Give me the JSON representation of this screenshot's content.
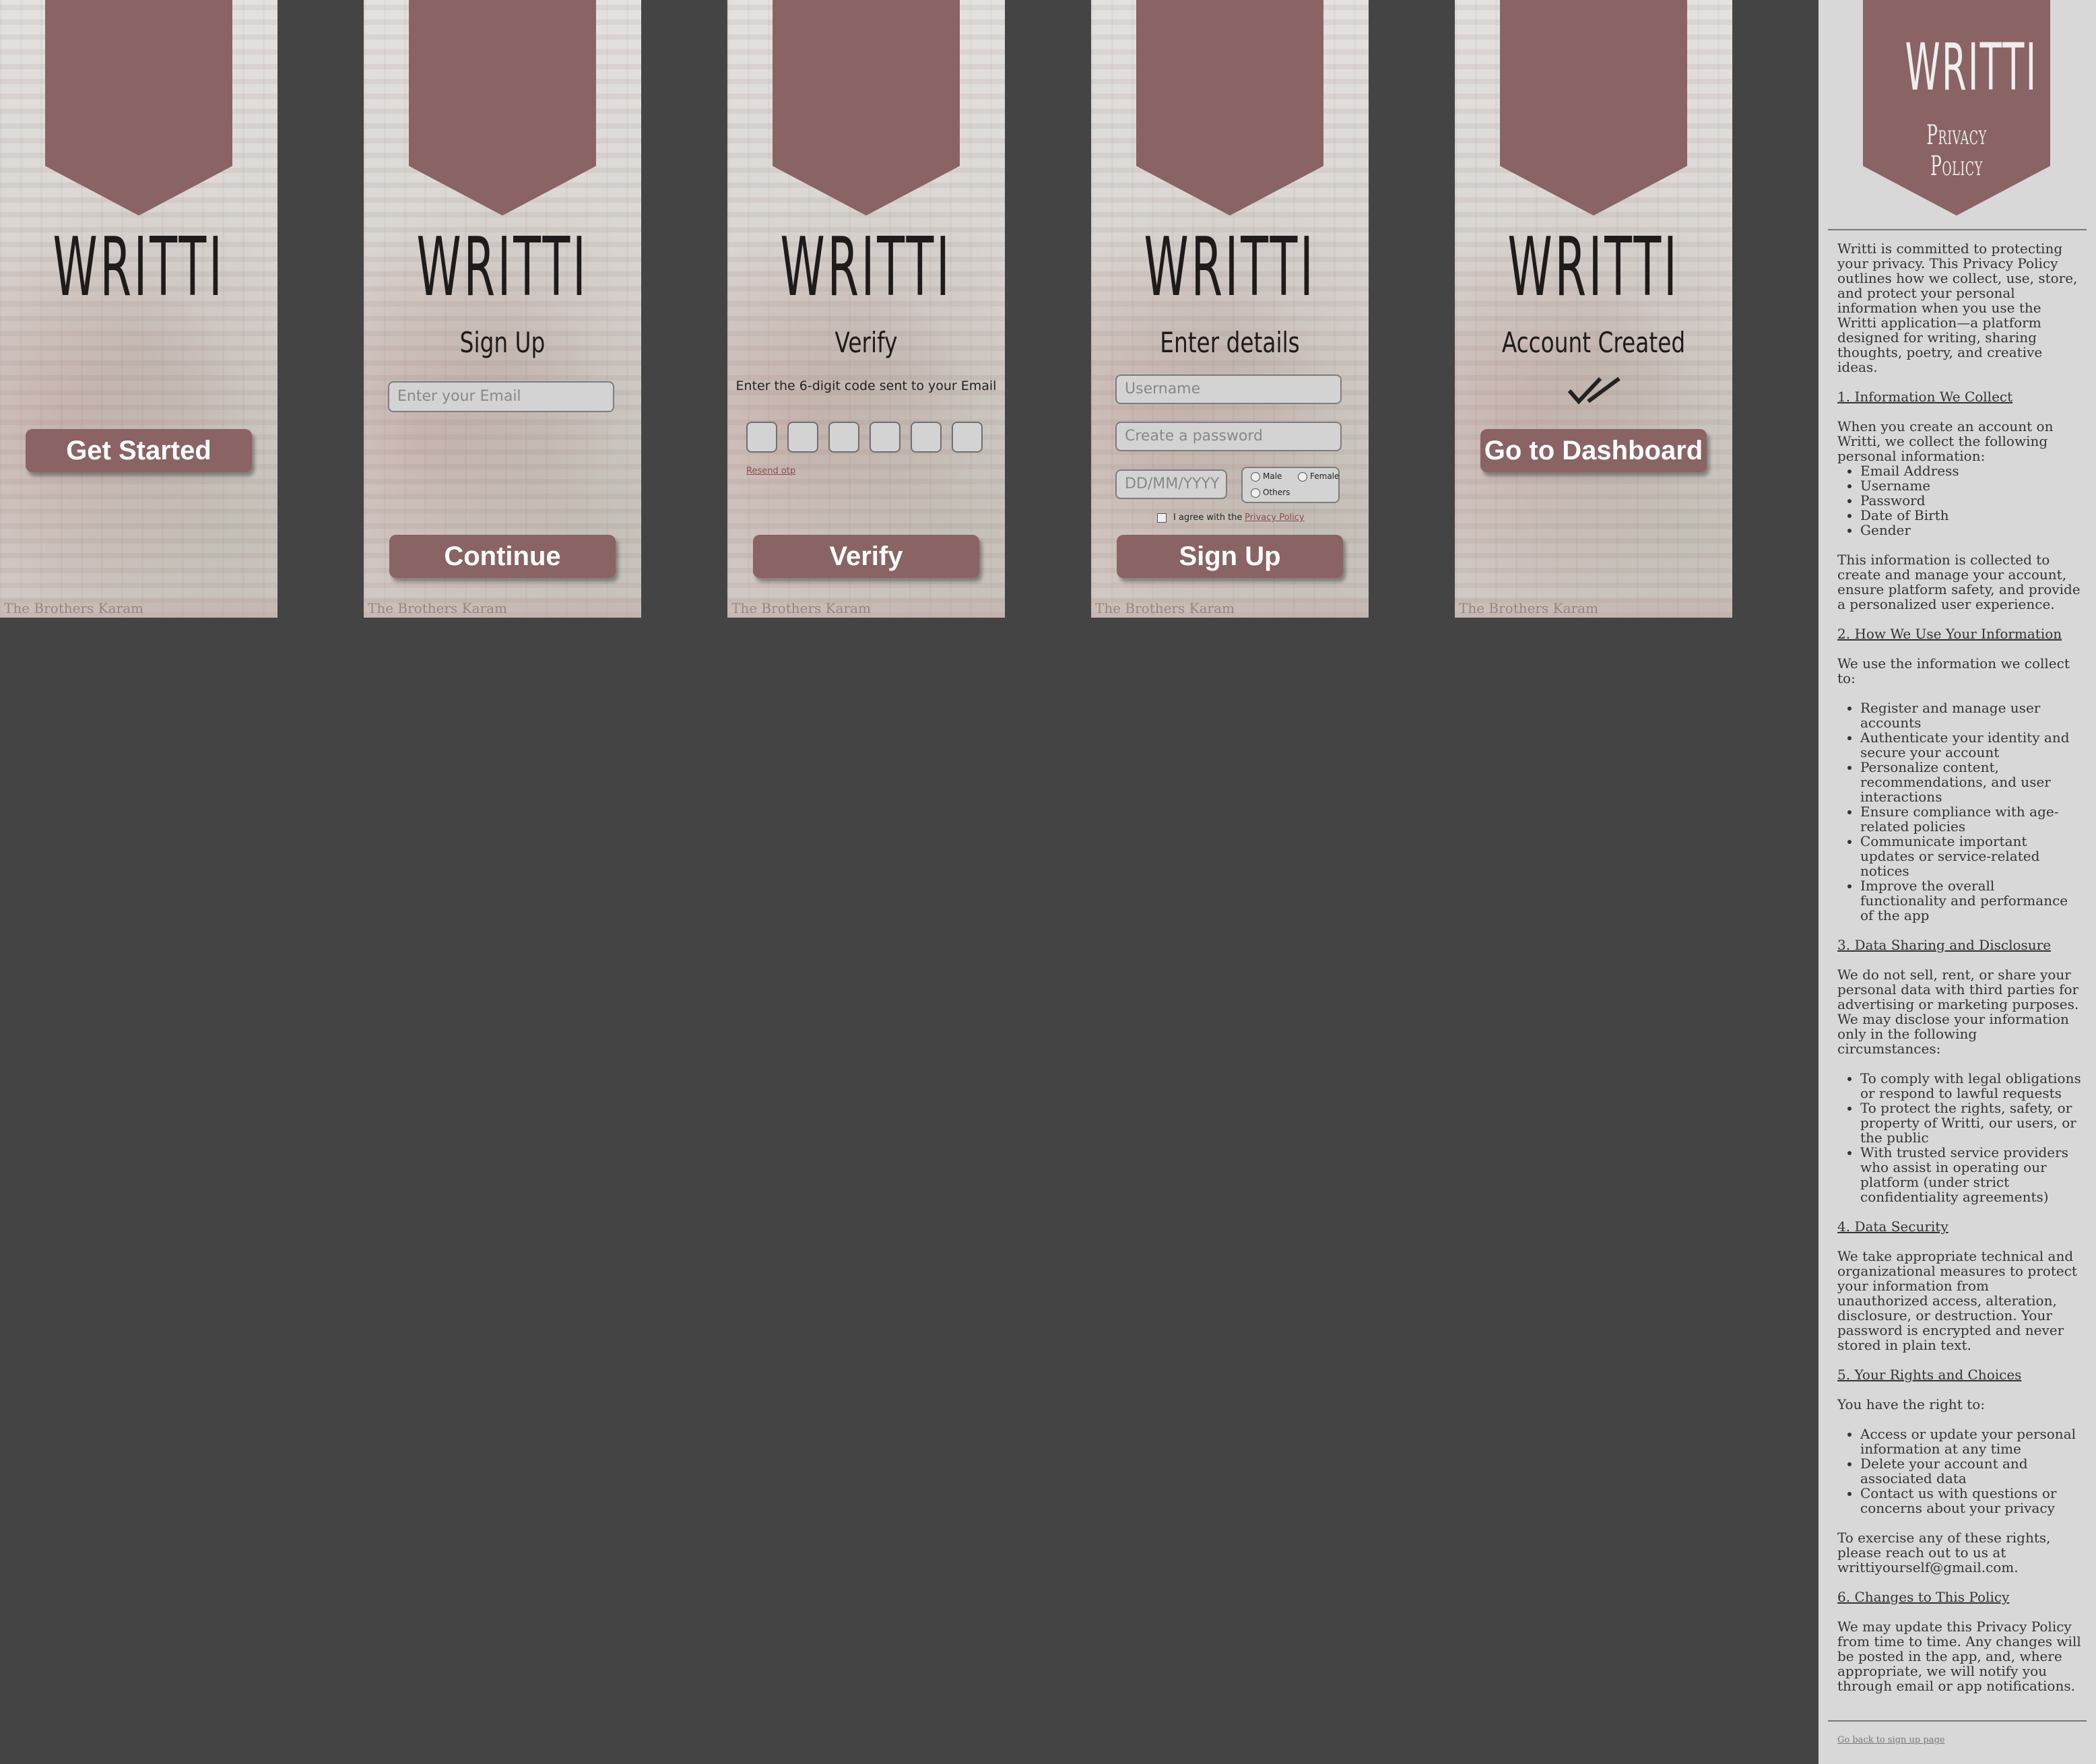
{
  "app": {
    "logo": "WRITTI"
  },
  "screens": {
    "welcome": {
      "button": "Get Started"
    },
    "signup": {
      "title": "Sign Up",
      "email_placeholder": "Enter your Email",
      "button": "Continue"
    },
    "verify": {
      "title": "Verify",
      "instruction": "Enter the 6-digit code sent to your Email",
      "resend": "Resend otp",
      "button": "Verify"
    },
    "details": {
      "title": "Enter details",
      "username_placeholder": "Username",
      "password_placeholder": "Create a password",
      "dob_placeholder": "DD/MM/YYYY",
      "gender_options": [
        "Male",
        "Female",
        "Others"
      ],
      "agree_text": "I agree with the",
      "privacy_link": "Privacy Policy",
      "button": "Sign Up"
    },
    "created": {
      "title": "Account Created",
      "icon": "double-check-icon",
      "button": "Go to Dashboard"
    }
  },
  "background_caption": "The Brothers Karam",
  "privacy": {
    "title": "WRITTI",
    "subtitle": "Privacy Policy",
    "intro": "Writti is committed to protecting your privacy. This Privacy Policy outlines how we collect, use, store, and protect your personal information when you use the Writti application—a platform designed for writing, sharing thoughts, poetry, and creative ideas.",
    "s1": {
      "heading": "1. Information We Collect",
      "text": "When you create an account on Writti, we collect the following personal information:",
      "items": [
        "Email Address",
        "Username",
        "Password",
        "Date of Birth",
        "Gender"
      ],
      "after": "This information is collected to create and manage your account, ensure platform safety, and provide a personalized user experience."
    },
    "s2": {
      "heading": "2. How We Use Your Information",
      "text": "We use the information we collect to:",
      "items": [
        "Register and manage user accounts",
        "Authenticate your identity and secure your account",
        "Personalize content, recommendations, and user interactions",
        "Ensure compliance with age-related policies",
        "Communicate important updates or service-related notices",
        "Improve the overall functionality and performance of the app"
      ]
    },
    "s3": {
      "heading": "3. Data Sharing and Disclosure",
      "text": "We do not sell, rent, or share your personal data with third parties for advertising or marketing purposes. We may disclose your information only in the following circumstances:",
      "items": [
        "To comply with legal obligations or respond to lawful requests",
        "To protect the rights, safety, or property of Writti, our users, or the public",
        "With trusted service providers who assist in operating our platform (under strict confidentiality agreements)"
      ]
    },
    "s4": {
      "heading": "4. Data Security",
      "text": "We take appropriate technical and organizational measures to protect your information from unauthorized access, alteration, disclosure, or destruction. Your password is encrypted and never stored in plain text."
    },
    "s5": {
      "heading": "5. Your Rights and Choices",
      "text": "You have the right to:",
      "items": [
        "Access or update your personal information at any time",
        "Delete your account and associated data",
        "Contact us with questions or concerns about your privacy"
      ],
      "after": "To exercise any of these rights, please reach out to us at writtiyourself@gmail.com."
    },
    "s6": {
      "heading": "6. Changes to This Policy",
      "text": "We may update this Privacy Policy from time to time. Any changes will be posted in the app, and, where appropriate, we will notify you through email or app notifications."
    },
    "back_link": "Go back to sign up page"
  },
  "colors": {
    "brand": "#8a6364",
    "canvas": "#444444",
    "panel": "#d8d8d8"
  }
}
